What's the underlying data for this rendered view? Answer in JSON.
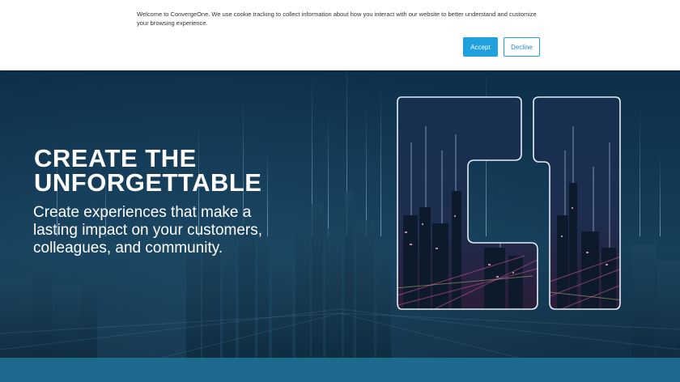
{
  "cookie_banner": {
    "message": "Welcome to ConvergeOne. We use cookie tracking to collect information about how you interact with our website to better understand and customize your browsing experience.",
    "accept_label": "Accept",
    "decline_label": "Decline"
  },
  "hero": {
    "title_line1": "CREATE THE",
    "title_line2": "UNFORGETTABLE",
    "subtitle": "Create experiences that make a lasting impact on your customers, colleagues, and community."
  },
  "colors": {
    "accent": "#1ea1dd",
    "hero_bg": "#113652",
    "bottom_strip": "#1d6a8e"
  }
}
